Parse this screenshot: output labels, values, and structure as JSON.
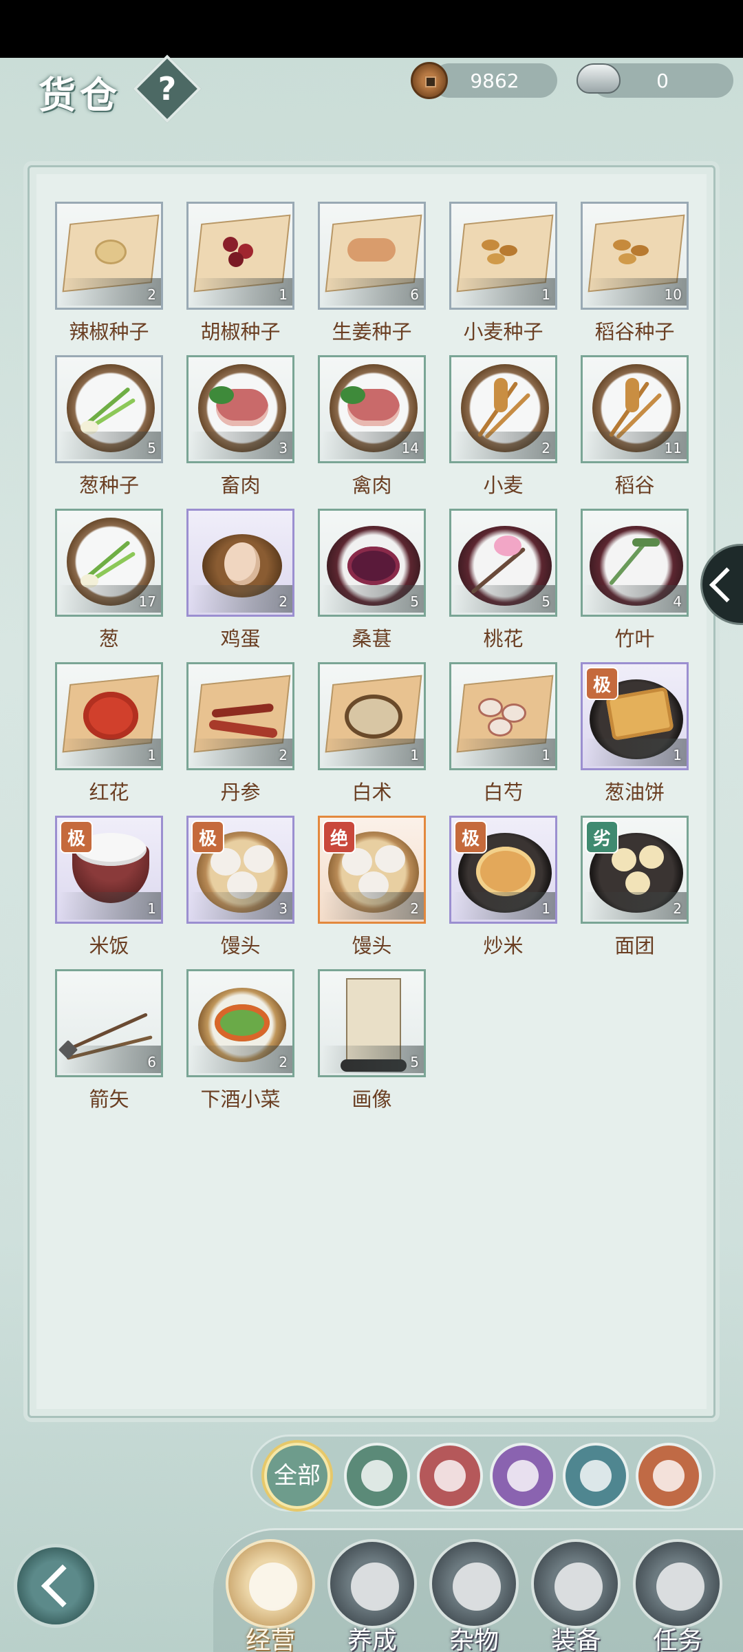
{
  "header": {
    "title": "货仓",
    "help_label": "?",
    "copper_coins": "9862",
    "silver_ingots": "0"
  },
  "items": [
    {
      "name": "辣椒种子",
      "count": "2",
      "frame": "paper",
      "art": "seeds",
      "badge": ""
    },
    {
      "name": "胡椒种子",
      "count": "1",
      "frame": "paper",
      "art": "berries",
      "badge": ""
    },
    {
      "name": "生姜种子",
      "count": "6",
      "frame": "paper",
      "art": "ginger",
      "badge": ""
    },
    {
      "name": "小麦种子",
      "count": "1",
      "frame": "paper",
      "art": "grain",
      "badge": ""
    },
    {
      "name": "稻谷种子",
      "count": "10",
      "frame": "paper",
      "art": "grain",
      "badge": ""
    },
    {
      "name": "葱种子",
      "count": "5",
      "frame": "paper",
      "art": "scallion",
      "badge": ""
    },
    {
      "name": "畜肉",
      "count": "3",
      "frame": "green",
      "art": "meat",
      "badge": ""
    },
    {
      "name": "禽肉",
      "count": "14",
      "frame": "green",
      "art": "meat",
      "badge": ""
    },
    {
      "name": "小麦",
      "count": "2",
      "frame": "green",
      "art": "wheat",
      "badge": ""
    },
    {
      "name": "稻谷",
      "count": "11",
      "frame": "green",
      "art": "wheat",
      "badge": ""
    },
    {
      "name": "葱",
      "count": "17",
      "frame": "green",
      "art": "scallion",
      "badge": ""
    },
    {
      "name": "鸡蛋",
      "count": "2",
      "frame": "purple",
      "art": "egg",
      "badge": ""
    },
    {
      "name": "桑葚",
      "count": "5",
      "frame": "green",
      "art": "mulberry",
      "badge": ""
    },
    {
      "name": "桃花",
      "count": "5",
      "frame": "green",
      "art": "blossom",
      "badge": ""
    },
    {
      "name": "竹叶",
      "count": "4",
      "frame": "green",
      "art": "leaf",
      "badge": ""
    },
    {
      "name": "红花",
      "count": "1",
      "frame": "green",
      "art": "safflower",
      "badge": ""
    },
    {
      "name": "丹参",
      "count": "2",
      "frame": "green",
      "art": "root",
      "badge": ""
    },
    {
      "name": "白术",
      "count": "1",
      "frame": "green",
      "art": "herb",
      "badge": ""
    },
    {
      "name": "白芍",
      "count": "1",
      "frame": "green",
      "art": "slices",
      "badge": ""
    },
    {
      "name": "葱油饼",
      "count": "1",
      "frame": "purple",
      "art": "pancake",
      "badge": "极"
    },
    {
      "name": "米饭",
      "count": "1",
      "frame": "purple",
      "art": "rice",
      "badge": "极"
    },
    {
      "name": "馒头",
      "count": "3",
      "frame": "purple",
      "art": "bun",
      "badge": "极"
    },
    {
      "name": "馒头",
      "count": "2",
      "frame": "orange",
      "art": "bun",
      "badge": "绝"
    },
    {
      "name": "炒米",
      "count": "1",
      "frame": "purple",
      "art": "friedrice",
      "badge": "极"
    },
    {
      "name": "面团",
      "count": "2",
      "frame": "green",
      "art": "dough",
      "badge": "劣"
    },
    {
      "name": "箭矢",
      "count": "6",
      "frame": "green",
      "art": "arrows",
      "badge": ""
    },
    {
      "name": "下酒小菜",
      "count": "2",
      "frame": "green",
      "art": "dish",
      "badge": ""
    },
    {
      "name": "画像",
      "count": "5",
      "frame": "green",
      "art": "scroll",
      "badge": ""
    }
  ],
  "filters": [
    {
      "label": "全部",
      "icon": "all-icon",
      "color": "#6e9c8c",
      "active": true
    },
    {
      "label": "",
      "icon": "sprout-icon",
      "color": "#5b8a78",
      "active": false
    },
    {
      "label": "",
      "icon": "food-bowl-icon",
      "color": "#b5585a",
      "active": false
    },
    {
      "label": "",
      "icon": "jar-icon",
      "color": "#8a63b0",
      "active": false
    },
    {
      "label": "",
      "icon": "mortar-icon",
      "color": "#4f8690",
      "active": false
    },
    {
      "label": "",
      "icon": "bow-icon",
      "color": "#c06a45",
      "active": false
    }
  ],
  "nav": [
    {
      "label": "经营",
      "icon": "bowl-icon",
      "active": true
    },
    {
      "label": "养成",
      "icon": "orb-icon",
      "active": false
    },
    {
      "label": "杂物",
      "icon": "bundle-icon",
      "active": false
    },
    {
      "label": "装备",
      "icon": "armor-icon",
      "active": false
    },
    {
      "label": "任务",
      "icon": "book-icon",
      "active": false
    }
  ]
}
